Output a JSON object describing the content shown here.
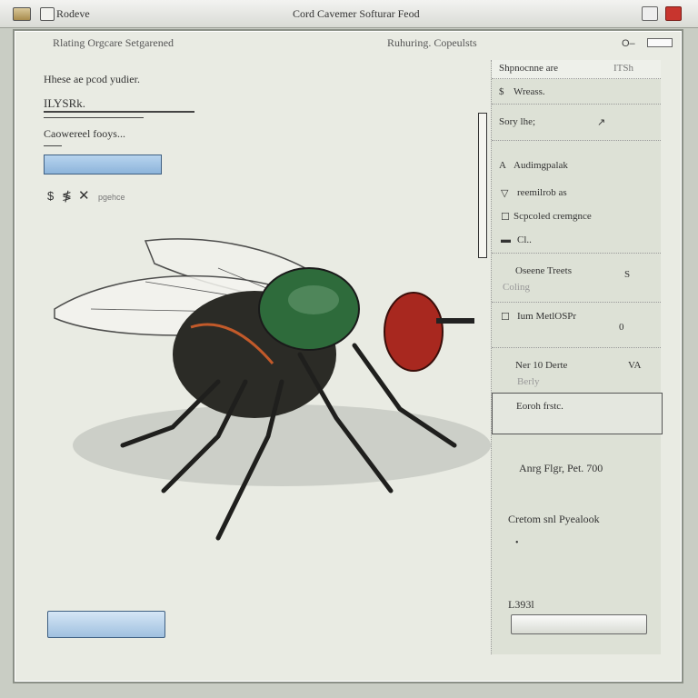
{
  "window": {
    "icon_label": "Rodeve",
    "title": "Cord Cavemer Softurar Feod"
  },
  "menu": {
    "left": "Rlating Orgcare Setgarened",
    "right": "Ruhuring.  Copeulsts"
  },
  "form": {
    "label1": "Hhese ae pcod yudier.",
    "field1_value": "ILYSRk.",
    "label2": "Caowereel fooys...",
    "field2_value": "",
    "tool_label": "pgehce",
    "bottom_left_button": ""
  },
  "panel": {
    "header": "Shpnocnne are",
    "header_right": "ITSh",
    "rows": [
      {
        "label": "Wreass.",
        "icon": "$"
      },
      {
        "label": "Sory lhe;",
        "icon": "↗"
      },
      {
        "label": "Audimgpalak",
        "icon": "A"
      },
      {
        "label": "reemilrob as",
        "icon": "▽"
      },
      {
        "label": "Scpcoled cremgnce",
        "icon": "☐"
      },
      {
        "label": "Cl..",
        "icon": "▬"
      },
      {
        "label": "Oseene Treets",
        "sub": "Coling",
        "right": "S"
      },
      {
        "label": "Ium MetlOSPr",
        "right": "0"
      },
      {
        "label": "Ner 10 Derte",
        "sub": "Berly",
        "right": "VA"
      },
      {
        "label": "Eoroh frstc.",
        "right": ""
      }
    ],
    "info1": "Anrg Flgr, Pet.  700",
    "info2": "Cretom snl Pyealook",
    "info3": "L393l",
    "bottom_right_button": ""
  },
  "colors": {
    "accent": "#8db4db",
    "close": "#c8352e",
    "panel": "#dde1d6"
  }
}
